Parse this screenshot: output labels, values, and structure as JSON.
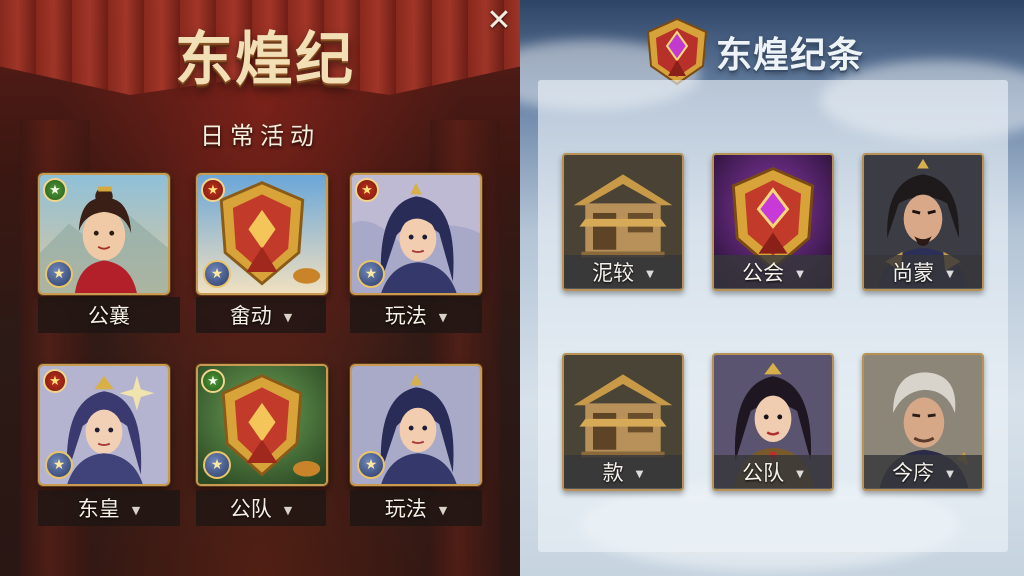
{
  "left": {
    "title": "东煌纪",
    "subtitle": "日常活动",
    "cards": [
      {
        "label": "公襄",
        "badge": "green",
        "art": "character-portrait"
      },
      {
        "label": "畬动",
        "badge": "red",
        "art": "guild-crest"
      },
      {
        "label": "玩法",
        "badge": "red",
        "art": "character-portrait"
      },
      {
        "label": "东皇",
        "badge": "red",
        "art": "character-portrait"
      },
      {
        "label": "公队",
        "badge": "green",
        "art": "guild-crest"
      },
      {
        "label": "玩法",
        "badge": "none",
        "art": "character-portrait"
      }
    ]
  },
  "right": {
    "title": "东煌纪条",
    "cards": [
      {
        "label": "泥较",
        "art": "pavilion"
      },
      {
        "label": "公会",
        "art": "purple-gem-crest"
      },
      {
        "label": "尚蒙",
        "art": "warrior-portrait"
      },
      {
        "label": "款",
        "art": "pavilion"
      },
      {
        "label": "公队",
        "art": "character-portrait"
      },
      {
        "label": "今庈",
        "art": "elder-portrait"
      }
    ]
  },
  "icons": {
    "close": "✕",
    "dropdown": "▼",
    "star": "★",
    "emblem_badge": "emblem-icon"
  },
  "colors": {
    "gold": "#c89a52",
    "crimson": "#a8382a",
    "sky": "#b3c4d6"
  }
}
